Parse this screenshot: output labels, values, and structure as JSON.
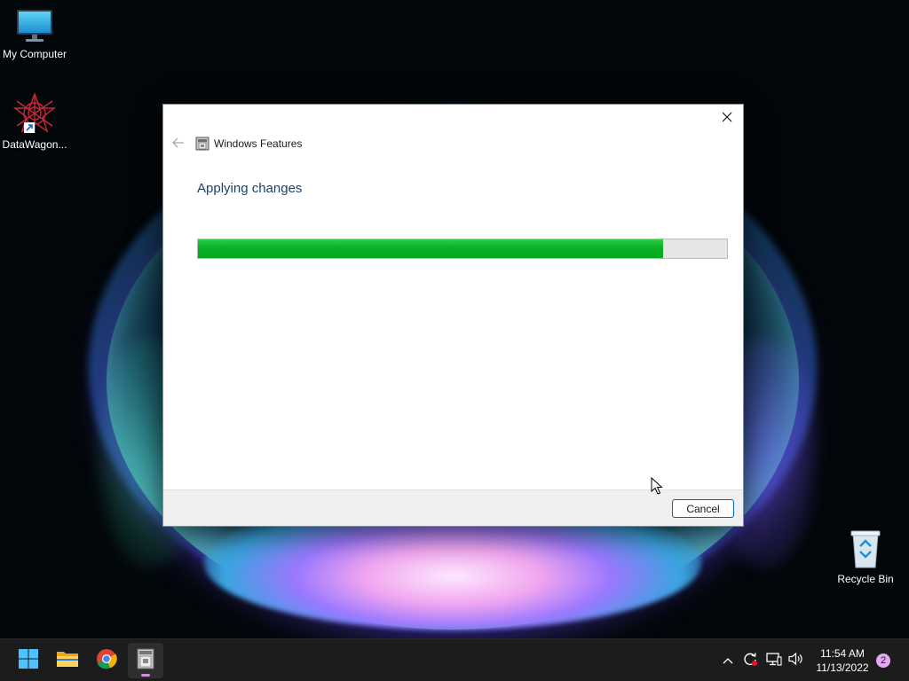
{
  "desktop": {
    "icons": [
      {
        "label": "My Computer",
        "icon": "monitor-icon"
      },
      {
        "label": "DataWagon...",
        "icon": "datawagon-icon"
      },
      {
        "label": "Recycle Bin",
        "icon": "recycle-bin-icon"
      }
    ]
  },
  "dialog": {
    "title": "Windows Features",
    "heading": "Applying changes",
    "progress_percent": 88,
    "progress_color": "#06b025",
    "cancel_label": "Cancel",
    "icons": {
      "close": "close-icon",
      "back": "back-arrow-icon",
      "app": "windows-features-icon"
    }
  },
  "taskbar": {
    "buttons": [
      {
        "name": "start",
        "icon": "windows-logo-icon"
      },
      {
        "name": "file-explorer",
        "icon": "folder-icon"
      },
      {
        "name": "chrome",
        "icon": "chrome-icon"
      },
      {
        "name": "windows-features",
        "icon": "windows-features-icon",
        "active": true
      }
    ],
    "tray": [
      "chevron-up-icon",
      "sync-icon",
      "network-icon",
      "volume-icon"
    ],
    "time": "11:54 AM",
    "date": "11/13/2022",
    "notification_count": "2"
  }
}
